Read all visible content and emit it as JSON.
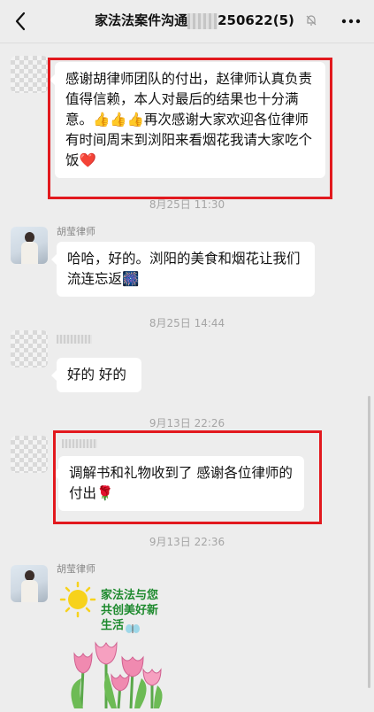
{
  "header": {
    "title_left": "家法法案件沟通",
    "title_right": "250622(5)"
  },
  "messages": [
    {
      "text": "感谢胡律师团队的付出，赵律师认真负责值得信赖，本人对最后的结果也十分满意。👍👍👍再次感谢大家欢迎各位律师有时间周末到浏阳来看烟花我请大家吃个饭❤️"
    },
    {
      "sender": "胡莹律师",
      "text": "哈哈，好的。浏阳的美食和烟花让我们流连忘返🎆"
    },
    {
      "text": "好的 好的"
    },
    {
      "text": "调解书和礼物收到了 感谢各位律师的付出🌹"
    },
    {
      "sender": "胡莹律师",
      "sticker_text": "家法法与您共创美好新生活"
    }
  ],
  "timestamps": [
    "8月25日 11:30",
    "8月25日 14:44",
    "9月13日 22:26",
    "9月13日 22:36"
  ],
  "colors": {
    "background": "#ededed",
    "bubble": "#ffffff",
    "highlight": "#e2191e",
    "sticker_text": "#1e8a2e"
  },
  "icons": [
    "back-arrow-icon",
    "mute-bell-icon",
    "more-icon"
  ]
}
